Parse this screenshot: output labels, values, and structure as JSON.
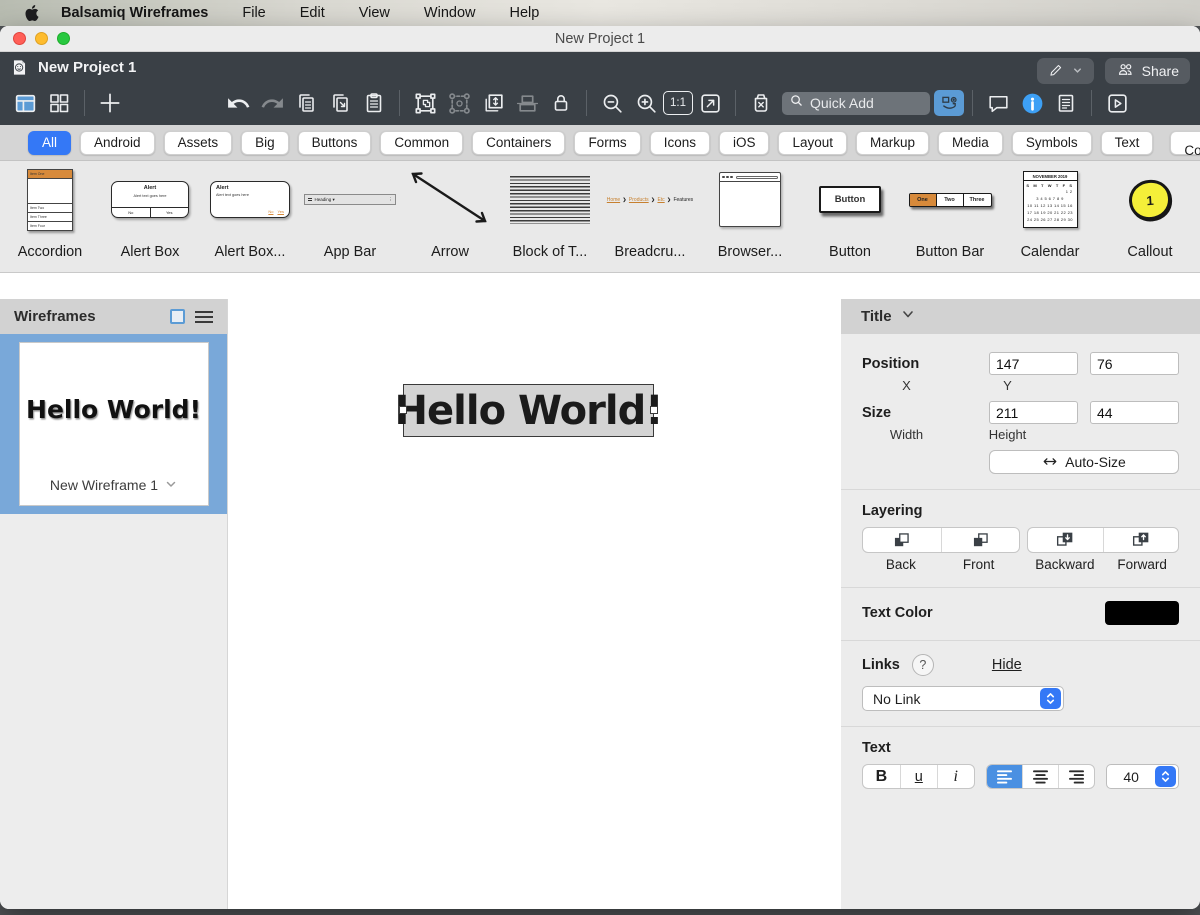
{
  "menu_bar": {
    "app_name": "Balsamiq Wireframes",
    "items": [
      "File",
      "Edit",
      "View",
      "Window",
      "Help"
    ]
  },
  "window": {
    "title": "New Project 1"
  },
  "toolbar": {
    "project_name": "New Project 1",
    "share_label": "Share",
    "quick_add_placeholder": "Quick Add",
    "zoom_actual_label": "1:1"
  },
  "tabs": {
    "items": [
      "All",
      "Android",
      "Assets",
      "Big",
      "Buttons",
      "Common",
      "Containers",
      "Forms",
      "Icons",
      "iOS",
      "Layout",
      "Markup",
      "Media",
      "Symbols",
      "Text",
      "More Controls..."
    ]
  },
  "palette": {
    "items": [
      {
        "label": "Accordion",
        "preview": {
          "header": "Item One",
          "rows": [
            "Item Two",
            "Item Three",
            "Item Four"
          ]
        }
      },
      {
        "label": "Alert Box",
        "preview": {
          "title": "Alert",
          "body": "Alert text goes here",
          "no": "No",
          "yes": "Yes"
        }
      },
      {
        "label": "Alert Box...",
        "preview": {
          "title": "Alert",
          "body": "Alert text goes here",
          "no": "No",
          "yes": "Yes"
        }
      },
      {
        "label": "App Bar",
        "preview": {
          "heading": "Heading ▾",
          "kebab": "⋮"
        }
      },
      {
        "label": "Arrow"
      },
      {
        "label": "Block of T..."
      },
      {
        "label": "Breadcru...",
        "preview": {
          "crumbs": [
            "Home",
            "Products",
            "Etc",
            "Features"
          ],
          "sep": "❯"
        }
      },
      {
        "label": "Browser..."
      },
      {
        "label": "Button",
        "preview": {
          "text": "Button"
        }
      },
      {
        "label": "Button Bar",
        "preview": {
          "segments": [
            "One",
            "Two",
            "Three"
          ]
        }
      },
      {
        "label": "Calendar",
        "preview": {
          "month": "NOVEMBER 2019",
          "days": "S M T W T F S",
          "weeks": [
            "1 2",
            "3 4 5 6 7 8 9",
            "10 11 12 13 14 15 16",
            "17 18 19 20 21 22 23",
            "24 25 26 27 28 29 30"
          ]
        }
      },
      {
        "label": "Callout",
        "preview": {
          "number": "1"
        }
      }
    ]
  },
  "sidebar": {
    "title": "Wireframes",
    "wireframe": {
      "name": "New Wireframe 1",
      "thumbnail_text": "Hello World!"
    }
  },
  "canvas": {
    "element_text": "Hello World!"
  },
  "inspector": {
    "header": "Title",
    "position": {
      "label": "Position",
      "x": "147",
      "y": "76",
      "x_label": "X",
      "y_label": "Y"
    },
    "size": {
      "label": "Size",
      "width": "211",
      "height": "44",
      "width_label": "Width",
      "height_label": "Height"
    },
    "auto_size_label": "Auto-Size",
    "layering": {
      "label": "Layering",
      "back": "Back",
      "front": "Front",
      "backward": "Backward",
      "forward": "Forward"
    },
    "text_color": {
      "label": "Text Color",
      "value": "#000000"
    },
    "links": {
      "label": "Links",
      "help": "?",
      "hide_label": "Hide",
      "selected": "No Link"
    },
    "text": {
      "label": "Text",
      "bold": "B",
      "underline": "u",
      "italic": "i",
      "font_size": "40"
    }
  },
  "colors": {
    "accent_blue": "#3478f6",
    "balsamiq_blue": "#5b9bd5",
    "selection_blue": "#79a8d9",
    "sketch_orange": "#d78a3b",
    "text_color_swatch": "#000000"
  }
}
